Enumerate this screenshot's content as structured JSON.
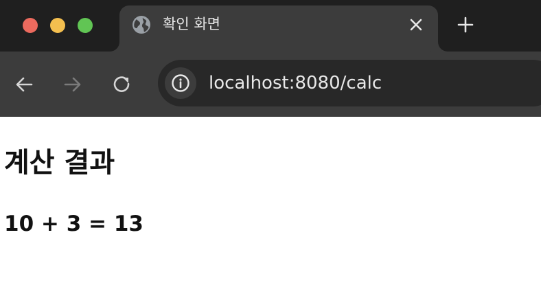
{
  "window": {
    "controls": [
      "close",
      "minimize",
      "maximize"
    ],
    "colors": {
      "close": "#ec6a5e",
      "minimize": "#f4bf4f",
      "maximize": "#61c554"
    }
  },
  "tab": {
    "title": "확인 화면",
    "favicon": "globe-icon",
    "close_icon": "close-icon"
  },
  "new_tab_icon": "plus-icon",
  "toolbar": {
    "back_icon": "arrow-left-icon",
    "forward_icon": "arrow-right-icon",
    "reload_icon": "reload-icon",
    "site_info_icon": "info-icon",
    "url": "localhost:8080/calc"
  },
  "page": {
    "heading": "계산 결과",
    "result": "10 + 3 = 13"
  }
}
